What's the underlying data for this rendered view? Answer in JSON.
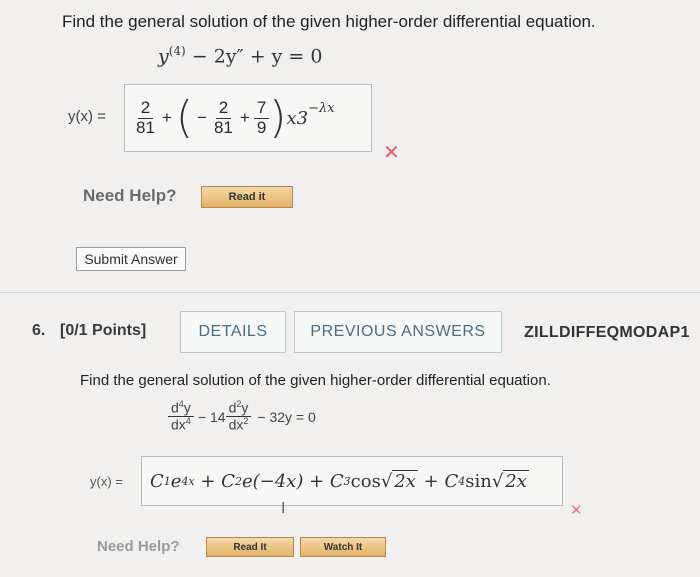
{
  "q5": {
    "prompt": "Find the general solution of the given higher-order differential equation.",
    "equation": {
      "y": "y",
      "order": "(4)",
      "mid": " − 2y″ + y = 0"
    },
    "answer": {
      "lhs": "y(x) =",
      "frac1": {
        "num": "2",
        "den": "81"
      },
      "plus1": "+",
      "minus": "−",
      "frac2": {
        "num": "2",
        "den": "81"
      },
      "plus2": "+",
      "frac3": {
        "num": "7",
        "den": "9"
      },
      "tail": "x3",
      "exp": "−λx"
    },
    "wrong_mark": "✕",
    "need_help": "Need Help?",
    "read_it": "Read it",
    "submit": "Submit Answer"
  },
  "q6": {
    "number": "6.",
    "points": "[0/1 Points]",
    "details_tab": "DETAILS",
    "previous_tab": "PREVIOUS ANSWERS",
    "course": "ZILLDIFFEQMODAP1",
    "prompt": "Find the general solution of the given higher-order differential equation.",
    "equation": {
      "d4": "d",
      "d4sup": "4",
      "d4y": "y",
      "d4den": "dx",
      "d4densup": "4",
      "minus1": "−",
      "coef": "14",
      "d2": "d",
      "d2sup": "2",
      "d2y": "y",
      "d2den": "dx",
      "d2densup": "2",
      "rest": "− 32y = 0"
    },
    "answer": {
      "lhs": "y(x) =",
      "c1": "C",
      "c1sub": "1",
      "e1": "e",
      "e1sup": "4x",
      "plus1": " + ",
      "c2": "C",
      "c2sub": "2",
      "e2": "e(−4x)",
      "plus2": " + ",
      "c3": "C",
      "c3sub": "3",
      "cos": "cos",
      "sqrt1": "2x",
      "plus3": " + ",
      "c4": "C",
      "c4sub": "4",
      "sin": "sin",
      "sqrt2": "2x"
    },
    "wrong_mark": "✕",
    "need_help": "Need Help?",
    "read_it": "Read It",
    "watch_it": "Watch It"
  },
  "colors": {
    "background": "#f1f0ee",
    "wrong": "#e05b6b",
    "tab_text": "#4a6e88",
    "help_button": "#e3b268"
  }
}
